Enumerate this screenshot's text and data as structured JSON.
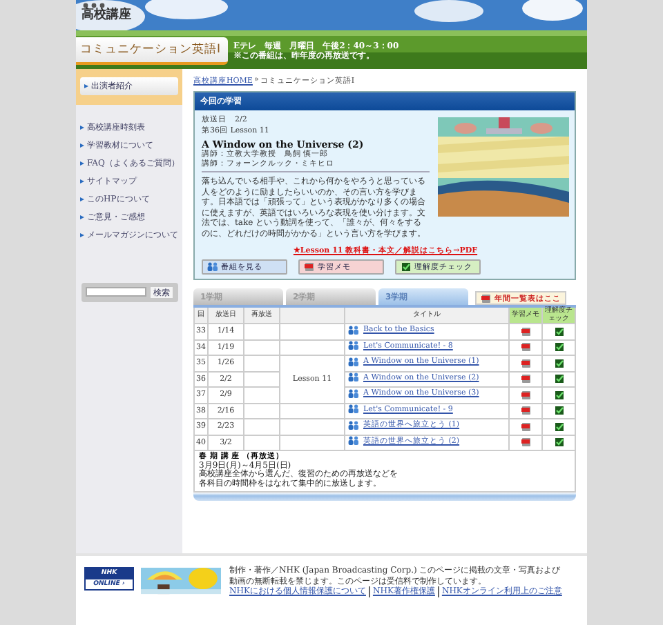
{
  "header": {
    "logo": "高校講座",
    "program_title": "コミュニケーション英語Ⅰ",
    "schedule": "Eテレ　毎週　月曜日　午後2：40～3：00",
    "note": "※この番組は、昨年度の再放送です。"
  },
  "sidebar": {
    "top_button": "出演者紹介",
    "links": [
      "高校講座時刻表",
      "学習教材について",
      "FAQ（よくあるご質問）",
      "サイトマップ",
      "このHPについて",
      "ご意見・ご感想",
      "メールマガジンについて"
    ],
    "search_button": "検索"
  },
  "breadcrumb": {
    "home": "高校講座HOME",
    "separator": "»",
    "current": "コミュニケーション英語Ⅰ"
  },
  "lesson": {
    "heading": "今回の学習",
    "air_date": "放送日　2/2",
    "episode": "第36回  Lesson 11",
    "title": "A Window on the Universe (2)",
    "lecturers": [
      "講師：立教大学教授　鳥飼 慎一郎",
      "講師：フォーンクルック・ミキヒロ"
    ],
    "description": "落ち込んでいる相手や、これから何かをやろうと思っている人をどのように励ましたらいいのか、その言い方を学びます。日本語では「頑張って」という表現がかなり多くの場合に使えますが、英語ではいろいろな表現を使い分けます。文法では、take という動詞を使って、「誰々が、何々をするのに、どれだけの時間がかかる」という言い方を学びます。",
    "pdf_link": "★Lesson 11 教科書・本文／解説はこちら→PDF",
    "buttons": [
      {
        "label": "番組を見る",
        "kind": "video"
      },
      {
        "label": "学習メモ",
        "kind": "memo"
      },
      {
        "label": "理解度チェック",
        "kind": "check"
      }
    ]
  },
  "terms": {
    "tabs": [
      {
        "label": "1学期",
        "selected": false
      },
      {
        "label": "2学期",
        "selected": false
      },
      {
        "label": "3学期",
        "selected": true
      }
    ],
    "yearly_button": "年間一覧表はここ"
  },
  "table": {
    "columns": [
      "回",
      "放送日",
      "再放送",
      "",
      "タイトル",
      "学習メモ",
      "理解度チェック"
    ],
    "blocks": [
      {
        "rows": [
          {
            "no": "33",
            "date": "1/14",
            "title": "Back to the Basics"
          }
        ]
      },
      {
        "rows": [
          {
            "no": "34",
            "date": "1/19",
            "title": "Let's Communicate! - 8"
          }
        ]
      },
      {
        "unit": "Lesson 11",
        "rows": [
          {
            "no": "35",
            "date": "1/26",
            "title": "A Window on the Universe (1)"
          },
          {
            "no": "36",
            "date": "2/2",
            "title": "A Window on the Universe (2)"
          },
          {
            "no": "37",
            "date": "2/9",
            "title": "A Window on the Universe (3)"
          }
        ]
      },
      {
        "rows": [
          {
            "no": "38",
            "date": "2/16",
            "title": "Let's Communicate! - 9"
          }
        ]
      },
      {
        "rows": [
          {
            "no": "39",
            "date": "2/23",
            "title": "英語の世界へ旅立とう (1)"
          }
        ]
      },
      {
        "rows": [
          {
            "no": "40",
            "date": "3/2",
            "title": "英語の世界へ旅立とう (2)"
          }
        ]
      }
    ],
    "notice": {
      "title": "春 期 講 座 （再放送）",
      "lines": [
        "3月9日(月)～4月5日(日)",
        "高校講座全体から選んだ、復習のための再放送などを",
        "各科目の時間枠をはなれて集中的に放送します。"
      ]
    }
  },
  "footer": {
    "logo_top": "NHK",
    "logo_bottom": "ONLINE ›",
    "lines": [
      "制作・著作／NHK (Japan Broadcasting Corp.) このページに掲載の文章・写真および",
      "動画の無断転載を禁じます。このページは受信料で制作しています。"
    ],
    "links": [
      "NHKにおける個人情報保護について",
      "NHK著作権保護",
      "NHKオンライン利用上のご注意"
    ]
  }
}
